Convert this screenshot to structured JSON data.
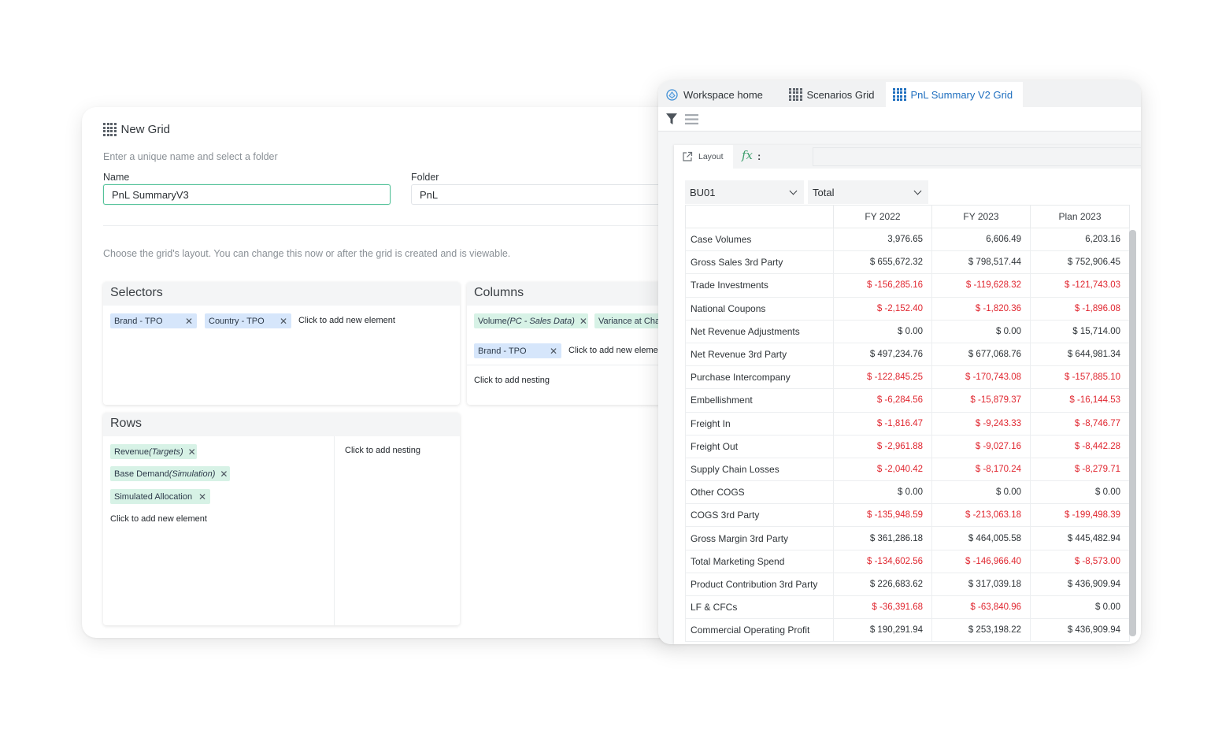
{
  "left": {
    "title": "New Grid",
    "subtitle": "Enter a unique name and select a folder",
    "name_label": "Name",
    "name_value": "PnL SummaryV3",
    "folder_label": "Folder",
    "folder_value": "PnL",
    "layout_hint": "Choose the grid's layout. You can change this now or after the grid is created and is viewable.",
    "selectors": {
      "title": "Selectors",
      "chips": [
        "Brand - TPO",
        "Country - TPO"
      ],
      "add_element": "Click to add new element"
    },
    "columns": {
      "title": "Columns",
      "chip1_main": "Volume",
      "chip1_sub": "(PC - Sales Data)",
      "chip2": "Variance at Cha",
      "chip3": "Brand - TPO",
      "add_element": "Click to add new eleme",
      "add_nesting": "Click to add nesting"
    },
    "rows": {
      "title": "Rows",
      "chip1_main": "Revenue",
      "chip1_sub": "(Targets)",
      "chip2_main": "Base Demand",
      "chip2_sub": "(Simulation)",
      "chip3": "Simulated Allocation",
      "add_element": "Click to add new element",
      "add_nesting": "Click to add nesting"
    }
  },
  "right": {
    "tabs": [
      "Workspace home",
      "Scenarios Grid",
      "PnL Summary V2 Grid"
    ],
    "active_tab": "PnL Summary V2 Grid",
    "layout_label": "Layout",
    "fx_label": "fx",
    "fx_colon": ":",
    "selector1": "BU01",
    "selector2": "Total",
    "accent_color": "#1f6fbf",
    "negative_color": "#e0262f",
    "table": {
      "columns": [
        "FY 2022",
        "FY 2023",
        "Plan 2023"
      ],
      "rows": [
        {
          "label": "Case Volumes",
          "values": [
            "3,976.65",
            "6,606.49",
            "6,203.16"
          ]
        },
        {
          "label": "Gross Sales 3rd Party",
          "values": [
            "$ 655,672.32",
            "$ 798,517.44",
            "$ 752,906.45"
          ]
        },
        {
          "label": "Trade Investments",
          "values": [
            "$ -156,285.16",
            "$ -119,628.32",
            "$ -121,743.03"
          ]
        },
        {
          "label": "National Coupons",
          "values": [
            "$ -2,152.40",
            "$ -1,820.36",
            "$ -1,896.08"
          ]
        },
        {
          "label": "Net Revenue Adjustments",
          "values": [
            "$ 0.00",
            "$ 0.00",
            "$ 15,714.00"
          ]
        },
        {
          "label": "Net Revenue 3rd Party",
          "values": [
            "$ 497,234.76",
            "$ 677,068.76",
            "$ 644,981.34"
          ]
        },
        {
          "label": "Purchase Intercompany",
          "values": [
            "$ -122,845.25",
            "$ -170,743.08",
            "$ -157,885.10"
          ]
        },
        {
          "label": "Embellishment",
          "values": [
            "$ -6,284.56",
            "$ -15,879.37",
            "$ -16,144.53"
          ]
        },
        {
          "label": "Freight In",
          "values": [
            "$ -1,816.47",
            "$ -9,243.33",
            "$ -8,746.77"
          ]
        },
        {
          "label": "Freight Out",
          "values": [
            "$ -2,961.88",
            "$ -9,027.16",
            "$ -8,442.28"
          ]
        },
        {
          "label": "Supply Chain Losses",
          "values": [
            "$ -2,040.42",
            "$ -8,170.24",
            "$ -8,279.71"
          ]
        },
        {
          "label": "Other COGS",
          "values": [
            "$ 0.00",
            "$ 0.00",
            "$ 0.00"
          ]
        },
        {
          "label": "COGS 3rd Party",
          "values": [
            "$ -135,948.59",
            "$ -213,063.18",
            "$ -199,498.39"
          ]
        },
        {
          "label": "Gross Margin 3rd Party",
          "values": [
            "$ 361,286.18",
            "$ 464,005.58",
            "$ 445,482.94"
          ]
        },
        {
          "label": "Total Marketing Spend",
          "values": [
            "$ -134,602.56",
            "$ -146,966.40",
            "$ -8,573.00"
          ]
        },
        {
          "label": "Product Contribution 3rd Party",
          "values": [
            "$ 226,683.62",
            "$ 317,039.18",
            "$ 436,909.94"
          ]
        },
        {
          "label": "LF & CFCs",
          "values": [
            "$ -36,391.68",
            "$ -63,840.96",
            "$ 0.00"
          ]
        },
        {
          "label": "Commercial Operating Profit",
          "values": [
            "$ 190,291.94",
            "$ 253,198.22",
            "$ 436,909.94"
          ]
        }
      ]
    }
  }
}
